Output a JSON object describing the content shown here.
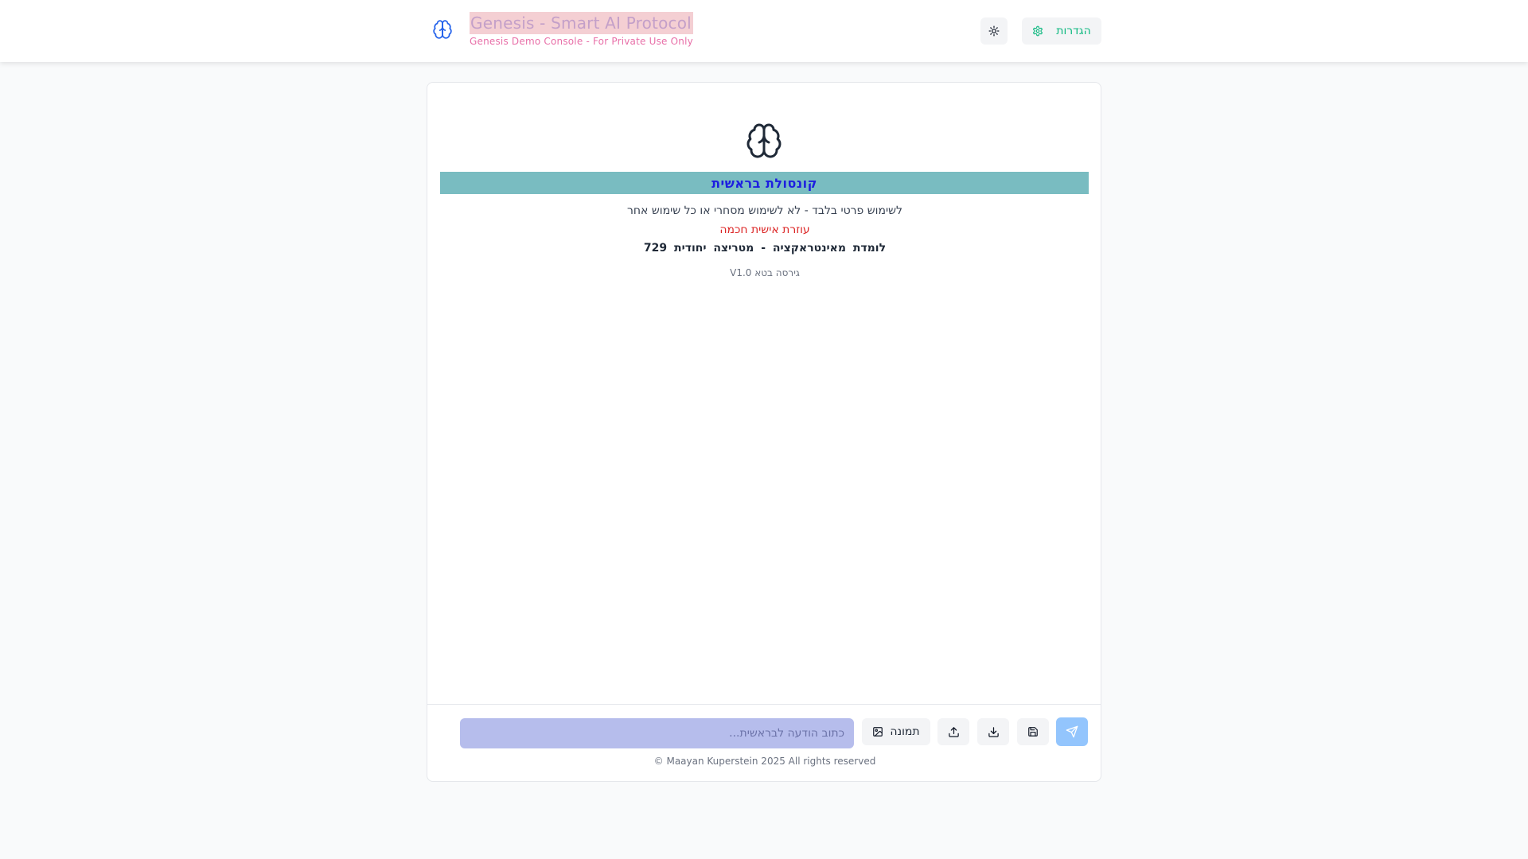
{
  "header": {
    "title": "Genesis - Smart AI Protocol",
    "subtitle": "Genesis Demo Console - For Private Use Only",
    "settings_label": "הגדרות",
    "icons": {
      "brand": "brain-icon",
      "theme": "sun-icon",
      "settings": "gear-icon"
    }
  },
  "main": {
    "console_title": "קונסולת בראשית",
    "private_use_note": "לשימוש פרטי בלבד - לא לשימוש מסחרי או כל שימוש אחר",
    "assistant_tagline": "עוזרת אישית חכמה",
    "learning_line": "לומדת מאינטראקציה - מטריצה יחודית 729",
    "version": "גירסה בטא V1.0",
    "icon": "brain-icon"
  },
  "composer": {
    "placeholder": "כתוב הודעה לבראשית...",
    "image_button_label": "תמונה",
    "icons": {
      "image": "image-icon",
      "upload": "upload-icon",
      "download": "download-icon",
      "save": "save-icon",
      "send": "send-icon"
    }
  },
  "footer": {
    "copyright": "© Maayan Kuperstein 2025 All rights reserved"
  },
  "colors": {
    "accent_green": "#10b981",
    "console_bar": "#79bcc1",
    "console_title": "#1d1ee0",
    "tagline_red": "#dc2626",
    "send_button": "#93c5fd",
    "input_bg": "#b6bdec",
    "subtitle_pink": "#e86fa8"
  }
}
